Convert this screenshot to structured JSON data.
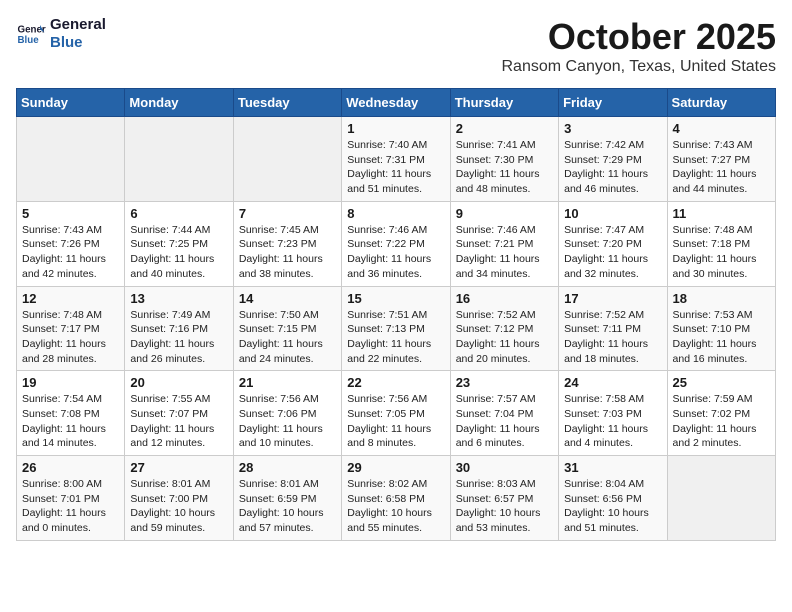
{
  "header": {
    "logo_line1": "General",
    "logo_line2": "Blue",
    "title": "October 2025",
    "subtitle": "Ransom Canyon, Texas, United States"
  },
  "weekdays": [
    "Sunday",
    "Monday",
    "Tuesday",
    "Wednesday",
    "Thursday",
    "Friday",
    "Saturday"
  ],
  "weeks": [
    [
      {
        "day": "",
        "info": ""
      },
      {
        "day": "",
        "info": ""
      },
      {
        "day": "",
        "info": ""
      },
      {
        "day": "1",
        "info": "Sunrise: 7:40 AM\nSunset: 7:31 PM\nDaylight: 11 hours and 51 minutes."
      },
      {
        "day": "2",
        "info": "Sunrise: 7:41 AM\nSunset: 7:30 PM\nDaylight: 11 hours and 48 minutes."
      },
      {
        "day": "3",
        "info": "Sunrise: 7:42 AM\nSunset: 7:29 PM\nDaylight: 11 hours and 46 minutes."
      },
      {
        "day": "4",
        "info": "Sunrise: 7:43 AM\nSunset: 7:27 PM\nDaylight: 11 hours and 44 minutes."
      }
    ],
    [
      {
        "day": "5",
        "info": "Sunrise: 7:43 AM\nSunset: 7:26 PM\nDaylight: 11 hours and 42 minutes."
      },
      {
        "day": "6",
        "info": "Sunrise: 7:44 AM\nSunset: 7:25 PM\nDaylight: 11 hours and 40 minutes."
      },
      {
        "day": "7",
        "info": "Sunrise: 7:45 AM\nSunset: 7:23 PM\nDaylight: 11 hours and 38 minutes."
      },
      {
        "day": "8",
        "info": "Sunrise: 7:46 AM\nSunset: 7:22 PM\nDaylight: 11 hours and 36 minutes."
      },
      {
        "day": "9",
        "info": "Sunrise: 7:46 AM\nSunset: 7:21 PM\nDaylight: 11 hours and 34 minutes."
      },
      {
        "day": "10",
        "info": "Sunrise: 7:47 AM\nSunset: 7:20 PM\nDaylight: 11 hours and 32 minutes."
      },
      {
        "day": "11",
        "info": "Sunrise: 7:48 AM\nSunset: 7:18 PM\nDaylight: 11 hours and 30 minutes."
      }
    ],
    [
      {
        "day": "12",
        "info": "Sunrise: 7:48 AM\nSunset: 7:17 PM\nDaylight: 11 hours and 28 minutes."
      },
      {
        "day": "13",
        "info": "Sunrise: 7:49 AM\nSunset: 7:16 PM\nDaylight: 11 hours and 26 minutes."
      },
      {
        "day": "14",
        "info": "Sunrise: 7:50 AM\nSunset: 7:15 PM\nDaylight: 11 hours and 24 minutes."
      },
      {
        "day": "15",
        "info": "Sunrise: 7:51 AM\nSunset: 7:13 PM\nDaylight: 11 hours and 22 minutes."
      },
      {
        "day": "16",
        "info": "Sunrise: 7:52 AM\nSunset: 7:12 PM\nDaylight: 11 hours and 20 minutes."
      },
      {
        "day": "17",
        "info": "Sunrise: 7:52 AM\nSunset: 7:11 PM\nDaylight: 11 hours and 18 minutes."
      },
      {
        "day": "18",
        "info": "Sunrise: 7:53 AM\nSunset: 7:10 PM\nDaylight: 11 hours and 16 minutes."
      }
    ],
    [
      {
        "day": "19",
        "info": "Sunrise: 7:54 AM\nSunset: 7:08 PM\nDaylight: 11 hours and 14 minutes."
      },
      {
        "day": "20",
        "info": "Sunrise: 7:55 AM\nSunset: 7:07 PM\nDaylight: 11 hours and 12 minutes."
      },
      {
        "day": "21",
        "info": "Sunrise: 7:56 AM\nSunset: 7:06 PM\nDaylight: 11 hours and 10 minutes."
      },
      {
        "day": "22",
        "info": "Sunrise: 7:56 AM\nSunset: 7:05 PM\nDaylight: 11 hours and 8 minutes."
      },
      {
        "day": "23",
        "info": "Sunrise: 7:57 AM\nSunset: 7:04 PM\nDaylight: 11 hours and 6 minutes."
      },
      {
        "day": "24",
        "info": "Sunrise: 7:58 AM\nSunset: 7:03 PM\nDaylight: 11 hours and 4 minutes."
      },
      {
        "day": "25",
        "info": "Sunrise: 7:59 AM\nSunset: 7:02 PM\nDaylight: 11 hours and 2 minutes."
      }
    ],
    [
      {
        "day": "26",
        "info": "Sunrise: 8:00 AM\nSunset: 7:01 PM\nDaylight: 11 hours and 0 minutes."
      },
      {
        "day": "27",
        "info": "Sunrise: 8:01 AM\nSunset: 7:00 PM\nDaylight: 10 hours and 59 minutes."
      },
      {
        "day": "28",
        "info": "Sunrise: 8:01 AM\nSunset: 6:59 PM\nDaylight: 10 hours and 57 minutes."
      },
      {
        "day": "29",
        "info": "Sunrise: 8:02 AM\nSunset: 6:58 PM\nDaylight: 10 hours and 55 minutes."
      },
      {
        "day": "30",
        "info": "Sunrise: 8:03 AM\nSunset: 6:57 PM\nDaylight: 10 hours and 53 minutes."
      },
      {
        "day": "31",
        "info": "Sunrise: 8:04 AM\nSunset: 6:56 PM\nDaylight: 10 hours and 51 minutes."
      },
      {
        "day": "",
        "info": ""
      }
    ]
  ]
}
